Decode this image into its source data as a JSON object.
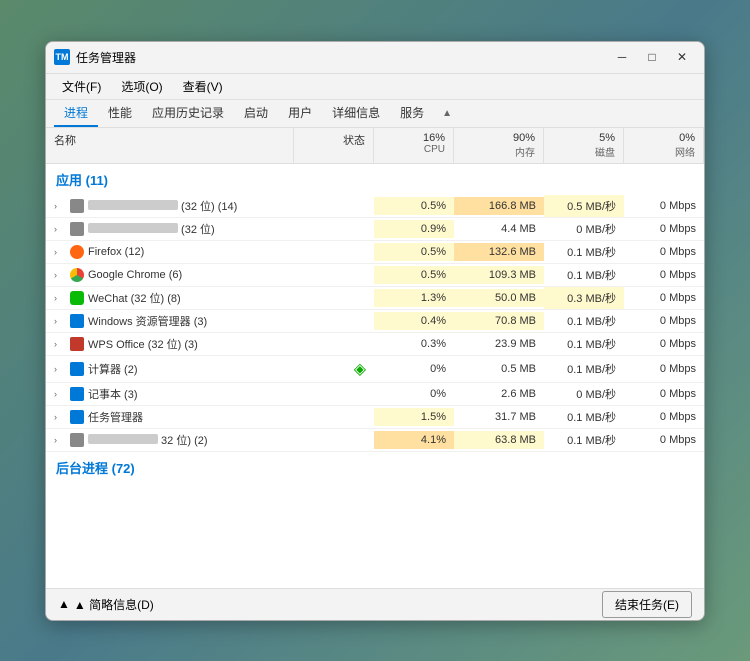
{
  "window": {
    "title": "任务管理器",
    "icon": "TM",
    "controls": {
      "minimize": "─",
      "maximize": "□",
      "close": "✕"
    }
  },
  "menu": {
    "items": [
      "文件(F)",
      "选项(O)",
      "查看(V)"
    ]
  },
  "tabs": [
    {
      "label": "进程",
      "active": true
    },
    {
      "label": "性能"
    },
    {
      "label": "应用历史记录"
    },
    {
      "label": "启动"
    },
    {
      "label": "用户"
    },
    {
      "label": "详细信息"
    },
    {
      "label": "服务"
    }
  ],
  "columns": [
    {
      "label": "名称",
      "sub": ""
    },
    {
      "label": "状态",
      "sub": ""
    },
    {
      "label": "16%",
      "sub": "CPU"
    },
    {
      "label": "90%",
      "sub": "内存"
    },
    {
      "label": "5%",
      "sub": "磁盘"
    },
    {
      "label": "0%",
      "sub": "网络"
    }
  ],
  "sections": [
    {
      "label": "应用 (11)",
      "rows": [
        {
          "name": "",
          "name_blurred": true,
          "name_blurred_w": 90,
          "extra": "(32 位) (14)",
          "status": "",
          "cpu": "0.5%",
          "mem": "166.8 MB",
          "disk": "0.5 MB/秒",
          "net": "0 Mbps",
          "cpu_heat": 1,
          "mem_heat": 2,
          "disk_heat": 1,
          "icon_type": "blurred"
        },
        {
          "name": "",
          "name_blurred": true,
          "name_blurred_w": 80,
          "extra": "(32 位)",
          "status": "",
          "cpu": "0.9%",
          "mem": "4.4 MB",
          "disk": "0 MB/秒",
          "net": "0 Mbps",
          "cpu_heat": 1,
          "mem_heat": 0,
          "disk_heat": 0,
          "icon_type": "blurred"
        },
        {
          "name": "Firefox",
          "extra": "(12)",
          "status": "",
          "cpu": "0.5%",
          "mem": "132.6 MB",
          "disk": "0.1 MB/秒",
          "net": "0 Mbps",
          "cpu_heat": 1,
          "mem_heat": 2,
          "disk_heat": 0,
          "icon_type": "firefox"
        },
        {
          "name": "Google Chrome",
          "extra": "(6)",
          "status": "",
          "cpu": "0.5%",
          "mem": "109.3 MB",
          "disk": "0.1 MB/秒",
          "net": "0 Mbps",
          "cpu_heat": 1,
          "mem_heat": 1,
          "disk_heat": 0,
          "icon_type": "chrome"
        },
        {
          "name": "WeChat",
          "extra": "(32 位) (8)",
          "status": "",
          "cpu": "1.3%",
          "mem": "50.0 MB",
          "disk": "0.3 MB/秒",
          "net": "0 Mbps",
          "cpu_heat": 2,
          "mem_heat": 1,
          "disk_heat": 1,
          "icon_type": "wechat"
        },
        {
          "name": "Windows 资源管理器",
          "extra": "(3)",
          "status": "",
          "cpu": "0.4%",
          "mem": "70.8 MB",
          "disk": "0.1 MB/秒",
          "net": "0 Mbps",
          "cpu_heat": 1,
          "mem_heat": 1,
          "disk_heat": 0,
          "icon_type": "windows"
        },
        {
          "name": "WPS Office",
          "extra": "(32 位) (3)",
          "status": "",
          "cpu": "0.3%",
          "mem": "23.9 MB",
          "disk": "0.1 MB/秒",
          "net": "0 Mbps",
          "cpu_heat": 0,
          "mem_heat": 0,
          "disk_heat": 0,
          "icon_type": "wps"
        },
        {
          "name": "计算器",
          "extra": "(2)",
          "status": "leaf",
          "cpu": "0%",
          "mem": "0.5 MB",
          "disk": "0.1 MB/秒",
          "net": "0 Mbps",
          "cpu_heat": 0,
          "mem_heat": 0,
          "disk_heat": 0,
          "icon_type": "calc"
        },
        {
          "name": "记事本",
          "extra": "(3)",
          "status": "",
          "cpu": "0%",
          "mem": "2.6 MB",
          "disk": "0 MB/秒",
          "net": "0 Mbps",
          "cpu_heat": 0,
          "mem_heat": 0,
          "disk_heat": 0,
          "icon_type": "notepad"
        },
        {
          "name": "任务管理器",
          "extra": "",
          "status": "",
          "cpu": "1.5%",
          "mem": "31.7 MB",
          "disk": "0.1 MB/秒",
          "net": "0 Mbps",
          "cpu_heat": 1,
          "mem_heat": 0,
          "disk_heat": 0,
          "icon_type": "taskman"
        },
        {
          "name": "",
          "name_blurred": true,
          "name_blurred_w": 70,
          "extra": "32 位) (2)",
          "status": "",
          "cpu": "4.1%",
          "mem": "63.8 MB",
          "disk": "0.1 MB/秒",
          "net": "0 Mbps",
          "cpu_heat": 2,
          "mem_heat": 1,
          "disk_heat": 0,
          "icon_type": "blurred"
        }
      ]
    },
    {
      "label": "后台进程 (72)",
      "rows": []
    }
  ],
  "bottom": {
    "summary_label": "▲ 简略信息(D)",
    "end_task_label": "结束任务(E)"
  }
}
